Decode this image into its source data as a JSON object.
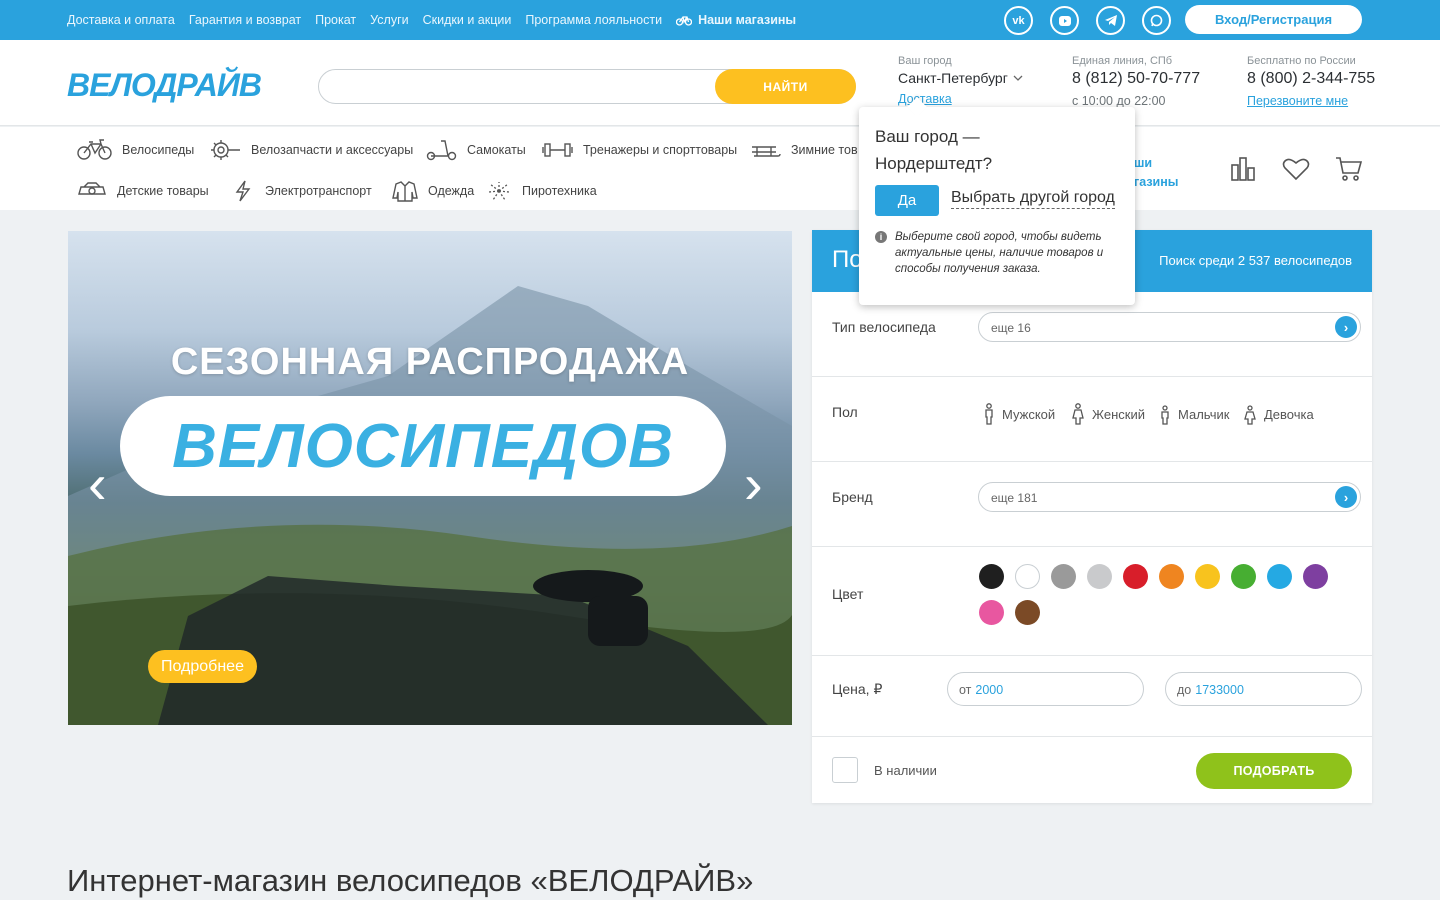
{
  "topbar": {
    "links": [
      "Доставка и оплата",
      "Гарантия и возврат",
      "Прокат",
      "Услуги",
      "Скидки и акции",
      "Программа лояльности"
    ],
    "stores_label": "Наши магазины",
    "socials": [
      "vk-icon",
      "youtube-icon",
      "telegram-icon",
      "chat-icon"
    ],
    "login_label": "Вход/Регистрация"
  },
  "header": {
    "logo": "ВЕЛОДРАЙВ",
    "search_button": "НАЙТИ",
    "city_label": "Ваш город",
    "city_value": "Санкт-Петербург",
    "delivery_link": "Доставка",
    "line_label": "Единая линия, СПб",
    "line_phone": "8 (812) 50-70-777",
    "line_hours": "с 10:00 до 22:00",
    "free_label": "Бесплатно по России",
    "free_phone": "8 (800) 2-344-755",
    "callback_link": "Перезвоните мне"
  },
  "categories": {
    "bikes": "Велосипеды",
    "parts": "Велозапчасти и аксессуары",
    "scooters": "Самокаты",
    "trainers": "Тренажеры и спорттовары",
    "winter": "Зимние товары",
    "kids": "Детские товары",
    "electric": "Электротранспорт",
    "clothes": "Одежда",
    "pyro": "Пиротехника",
    "stores_line1": "Наши",
    "stores_line2": "магазины"
  },
  "hero": {
    "line1": "СЕЗОННАЯ РАСПРОДАЖА",
    "line2": "ВЕЛОСИПЕДОВ",
    "more_button": "Подробнее",
    "prev": "‹",
    "next": "›"
  },
  "filter": {
    "title": "Подбор",
    "count": "Поиск среди 2 537 велосипедов",
    "type_label": "Тип велосипеда",
    "type_placeholder": "еще 16",
    "gender_label": "Пол",
    "genders": [
      "Мужской",
      "Женский",
      "Мальчик",
      "Девочка"
    ],
    "brand_label": "Бренд",
    "brand_placeholder": "еще 181",
    "color_label": "Цвет",
    "colors": [
      "#1f1f1f",
      "#ffffff",
      "#9a9a9a",
      "#c9cacc",
      "#d81e2a",
      "#ef8520",
      "#f8c31e",
      "#47ae32",
      "#25a9e3",
      "#7e3fa0",
      "#e857a0",
      "#7b4a26"
    ],
    "price_label": "Цена, ₽",
    "price_from_label": "от",
    "price_from": "2000",
    "price_to_label": "до",
    "price_to": "1733000",
    "in_stock": "В наличии",
    "pick_button": "ПОДОБРАТЬ"
  },
  "popup": {
    "question": "Ваш город —",
    "question_city": "Нордерштедт?",
    "yes": "Да",
    "other": "Выбрать другой город",
    "info": "Выберите свой город, чтобы видеть актуальные цены, наличие товаров и способы получения заказа."
  },
  "page_title": "Интернет-магазин велосипедов «ВЕЛОДРАЙВ»"
}
